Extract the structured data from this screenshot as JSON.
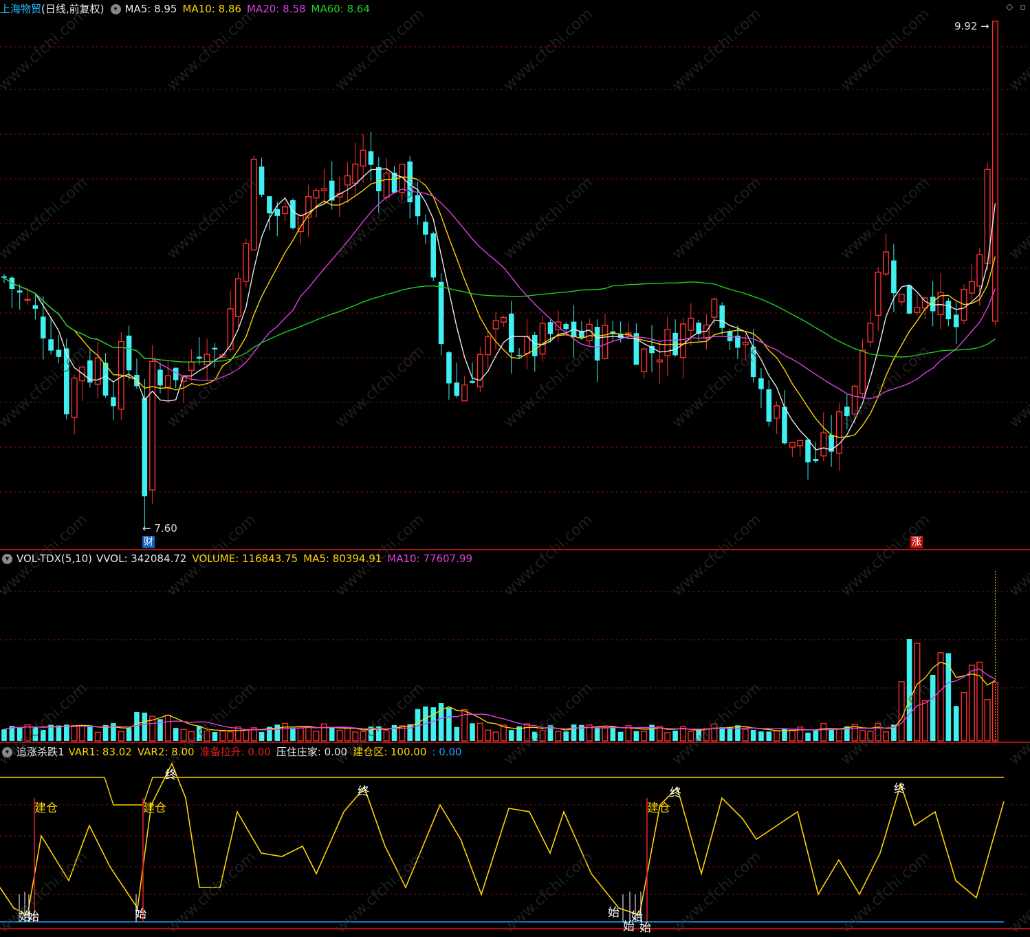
{
  "main_panel": {
    "title": "上海物贸",
    "period": "(日线,前复权)",
    "indicators": [
      {
        "label": "MA5:",
        "value": "8.95",
        "color": "#e8e8e8"
      },
      {
        "label": "MA10:",
        "value": "8.86",
        "color": "#ffd400"
      },
      {
        "label": "MA20:",
        "value": "8.58",
        "color": "#e040e0"
      },
      {
        "label": "MA60:",
        "value": "8.64",
        "color": "#20d020"
      }
    ],
    "high_label": "9.92",
    "low_label": "7.60",
    "badge_low": "财",
    "badge_high": "涨"
  },
  "volume_panel": {
    "name": "VOL-TDX(5,10)",
    "indicators": [
      {
        "label": "VVOL:",
        "value": "342084.72",
        "color": "#e8e8e8"
      },
      {
        "label": "VOLUME:",
        "value": "116843.75",
        "color": "#ffd400"
      },
      {
        "label": "MA5:",
        "value": "80394.91",
        "color": "#ffd400"
      },
      {
        "label": "MA10:",
        "value": "77607.99",
        "color": "#e040e0"
      }
    ]
  },
  "indicator_panel": {
    "name": "追涨杀跌1",
    "indicators": [
      {
        "label": "VAR1:",
        "value": "83.02",
        "color": "#ffd400"
      },
      {
        "label": "VAR2:",
        "value": "8.00",
        "color": "#ffd400"
      },
      {
        "label": "准备拉升:",
        "value": "0.00",
        "color": "#e02020"
      },
      {
        "label": "压住庄家:",
        "value": "0.00",
        "color": "#e8e8e8"
      },
      {
        "label": "建仓区:",
        "value": "100.00",
        "color": "#ffd400"
      },
      {
        "label": ":",
        "value": "0.00",
        "color": "#20a0ff"
      }
    ],
    "signals": {
      "build": "建仓",
      "start": "始",
      "end": "终"
    }
  },
  "watermark": "www.cfchi.com",
  "colors": {
    "up": "#ff3030",
    "down": "#40f0f0",
    "grid": "#8a1010",
    "divider": "#b01010"
  }
}
